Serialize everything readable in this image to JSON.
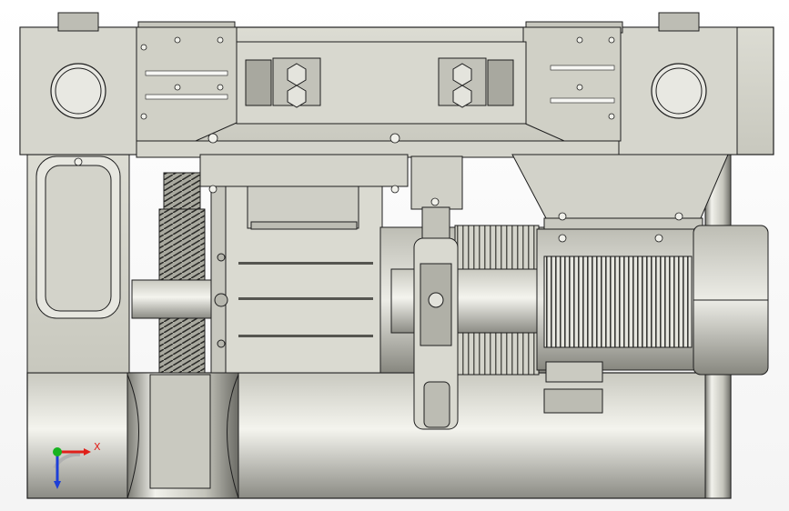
{
  "scene": {
    "subject": "hoist-assembly-cad-model",
    "colors": {
      "metal_light": "#d9d9cf",
      "metal_mid": "#b9b9ae",
      "metal_dark": "#6f6f68",
      "outline": "#1e1e1e",
      "background": "#ffffff"
    }
  },
  "triad": {
    "x_label": "X",
    "x_color": "#e0201a",
    "y_color": "#17b320",
    "z_color": "#1d3fd8"
  }
}
